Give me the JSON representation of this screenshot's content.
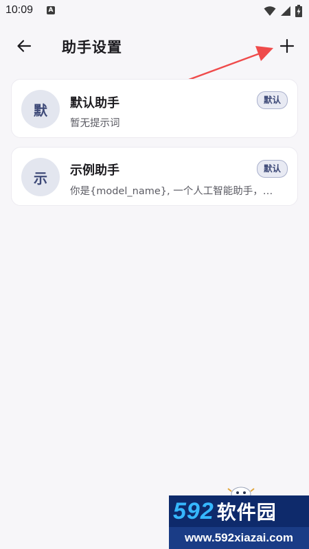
{
  "status_bar": {
    "time": "10:09",
    "notification_icon": "a-icon",
    "wifi_icon": "wifi-icon",
    "signal_icon": "signal-icon",
    "battery_icon": "battery-charging-icon"
  },
  "header": {
    "title": "助手设置",
    "back_icon": "arrow-left-icon",
    "add_icon": "plus-icon"
  },
  "assistants": [
    {
      "avatar": "默",
      "name": "默认助手",
      "prompt": "暂无提示词",
      "badge": "默认"
    },
    {
      "avatar": "示",
      "name": "示例助手",
      "prompt": "你是{model_name}, 一个人工智能助手，…",
      "badge": "默认"
    }
  ],
  "watermark": {
    "brand_number": "592",
    "brand_text": "软件园",
    "url": "www.592xiazai.com"
  },
  "colors": {
    "background": "#f7f6f9",
    "card": "#ffffff",
    "avatar_bg": "#e3e6ef",
    "accent": "#3e4a78",
    "annotation_arrow": "#ef4b4b"
  }
}
